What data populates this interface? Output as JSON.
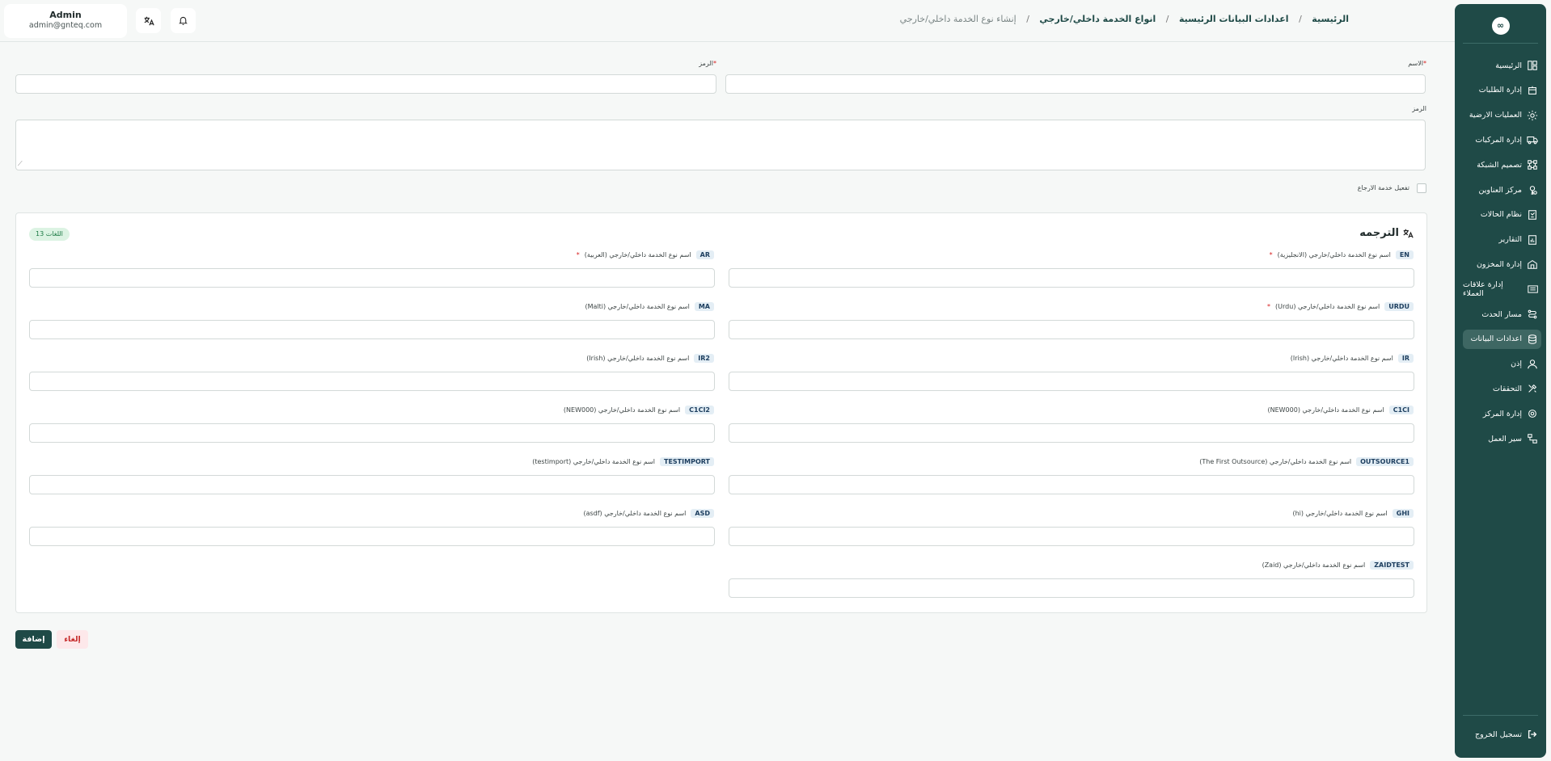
{
  "sidebar": {
    "items": [
      {
        "label": "الرئيسية",
        "icon": "layout-icon"
      },
      {
        "label": "إدارة الطلبات",
        "icon": "box-icon"
      },
      {
        "label": "العمليات الارضية",
        "icon": "gear-icon"
      },
      {
        "label": "إدارة المركبات",
        "icon": "truck-icon"
      },
      {
        "label": "تصميم الشبكة",
        "icon": "network-icon"
      },
      {
        "label": "مركز العناوين",
        "icon": "map-pin-icon"
      },
      {
        "label": "نظام الحالات",
        "icon": "status-icon"
      },
      {
        "label": "التقارير",
        "icon": "report-icon"
      },
      {
        "label": "إدارة المخزون",
        "icon": "warehouse-icon"
      },
      {
        "label": "إدارة علاقات العملاء",
        "icon": "crm-icon"
      },
      {
        "label": "مسار الحدث",
        "icon": "route-icon"
      },
      {
        "label": "اعدادات البيانات",
        "icon": "database-icon"
      },
      {
        "label": "إذن",
        "icon": "user-icon"
      },
      {
        "label": "التحققات",
        "icon": "tools-icon"
      },
      {
        "label": "إدارة المركز",
        "icon": "center-icon"
      },
      {
        "label": "سير العمل",
        "icon": "workflow-icon"
      }
    ],
    "active_label": "اعدادات البيانات",
    "logout_label": "تسجيل الخروج"
  },
  "user": {
    "name": "Admin",
    "email": "admin@gnteq.com"
  },
  "breadcrumb": {
    "home": "الرئيسية",
    "level2": "اعدادات البيانات الرئيسية",
    "level3": "انواع الخدمة داخلي/خارجي",
    "current": "إنشاء نوع الخدمة داخلي/خارجي",
    "separator": "/"
  },
  "form": {
    "name_label": "الاسم",
    "code_label": "الرمز",
    "description_label": "الرمز",
    "required_mark": "*",
    "return_service_label": "تفعيل خدمة الارجاع"
  },
  "translation": {
    "title": "الترجمه",
    "languages_badge": "13 اللغات",
    "fields": [
      {
        "code": "EN",
        "label": "اسم نوع الخدمة داخلي/خارجي (الانجليزية)",
        "required": true
      },
      {
        "code": "AR",
        "label": "اسم نوع الخدمة داخلي/خارجي (العربية)",
        "required": true
      },
      {
        "code": "URDU",
        "label": "اسم نوع الخدمة داخلي/خارجي (Urdu)",
        "required": true
      },
      {
        "code": "MA",
        "label": "اسم نوع الخدمة داخلي/خارجي (Malti)",
        "required": false
      },
      {
        "code": "IR",
        "label": "اسم نوع الخدمة داخلي/خارجي (Irish)",
        "required": false
      },
      {
        "code": "IR2",
        "label": "اسم نوع الخدمة داخلي/خارجي (Irish)",
        "required": false
      },
      {
        "code": "C1CI",
        "label": "اسم نوع الخدمة داخلي/خارجي (NEW000)",
        "required": false
      },
      {
        "code": "C1CI2",
        "label": "اسم نوع الخدمة داخلي/خارجي (NEW000)",
        "required": false
      },
      {
        "code": "OUTSOURCE1",
        "label": "اسم نوع الخدمة داخلي/خارجي (The First Outsource)",
        "required": false
      },
      {
        "code": "TESTIMPORT",
        "label": "اسم نوع الخدمة داخلي/خارجي (testimport)",
        "required": false
      },
      {
        "code": "GHI",
        "label": "اسم نوع الخدمة داخلي/خارجي (hi)",
        "required": false
      },
      {
        "code": "ASD",
        "label": "اسم نوع الخدمة داخلي/خارجي (asdf)",
        "required": false
      },
      {
        "code": "ZAIDTEST",
        "label": "اسم نوع الخدمة داخلي/خارجي (Zaid)",
        "required": false
      }
    ]
  },
  "actions": {
    "add_label": "إضافة",
    "cancel_label": "إلغاء"
  },
  "colors": {
    "primary": "#1f4a47",
    "danger": "#d72020",
    "success": "#1c7a44",
    "background": "#f6f8f7"
  }
}
